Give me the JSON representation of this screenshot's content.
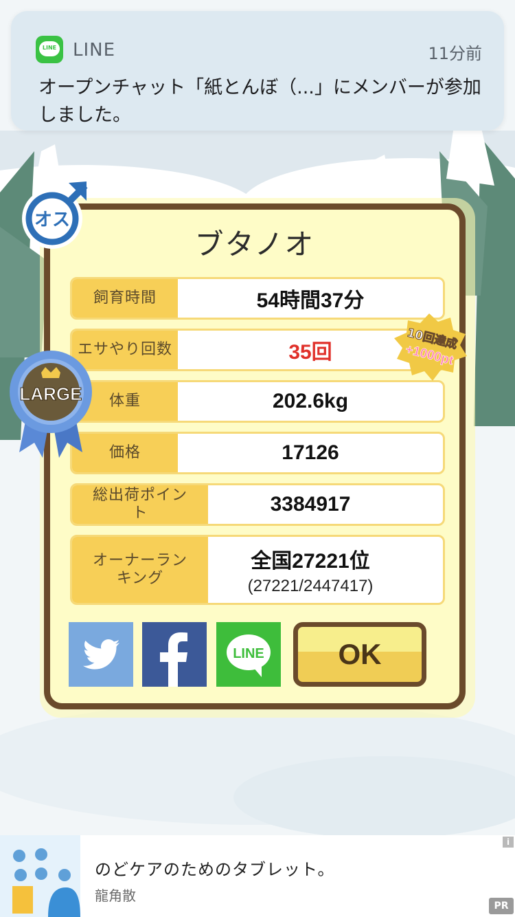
{
  "notification": {
    "app_name": "LINE",
    "app_icon_text": "LINE",
    "time": "11分前",
    "message": "オープンチャット「紙とんぼ（...」にメンバーが参加しました。"
  },
  "card": {
    "name": "ブタノオ",
    "gender_badge": "オス",
    "size_badge": "LARGE",
    "achievement_line1": "10回達成",
    "achievement_line2": "+1000pt",
    "rows": [
      {
        "label": "飼育時間",
        "value": "54時間37分"
      },
      {
        "label": "エサやり回数",
        "value": "35回",
        "color": "#e0302a"
      },
      {
        "label": "体重",
        "value": "202.6kg"
      },
      {
        "label": "価格",
        "value": "17126"
      },
      {
        "label": "総出荷ポイント",
        "value": "3384917"
      },
      {
        "label": "オーナーランキング",
        "value": "全国27221位",
        "sub": "(27221/2447417)"
      }
    ],
    "share_buttons": [
      "twitter-icon",
      "facebook-icon",
      "line-icon"
    ],
    "line_share_text": "LINE",
    "ok_label": "OK"
  },
  "ad": {
    "title": "のどケアのためのタブレット。",
    "sponsor": "龍角散",
    "pr_label": "PR",
    "info_label": "i"
  },
  "colors": {
    "accent_yellow": "#f7cf57",
    "card_border": "#6a4a2b",
    "highlight_red": "#e0302a",
    "line_green": "#3ac244"
  }
}
